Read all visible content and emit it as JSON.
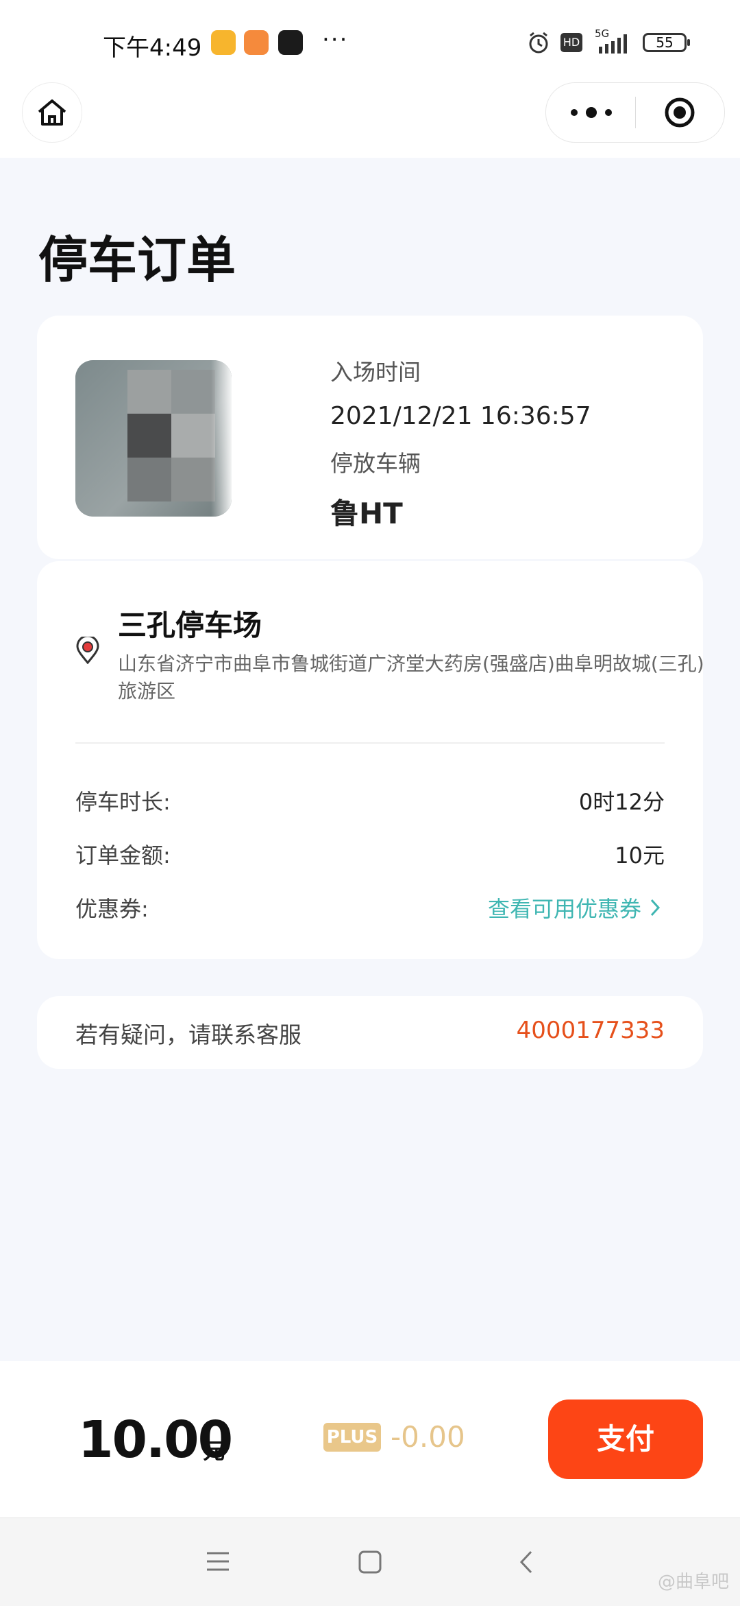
{
  "status_bar": {
    "time": "下午4:49",
    "more": "···",
    "hd_label": "HD",
    "network": "5G",
    "battery": "55"
  },
  "nav": {
    "home_icon": "home-icon",
    "more_icon": "more-dots-icon",
    "close_icon": "target-circle-icon"
  },
  "page": {
    "title": "停车订单"
  },
  "order": {
    "entry_label": "入场时间",
    "entry_time": "2021/12/21 16:36:57",
    "plate_label": "停放车辆",
    "plate_value": "鲁HT"
  },
  "lot": {
    "name": "三孔停车场",
    "address": "山东省济宁市曲阜市鲁城街道广济堂大药房(强盛店)曲阜明故城(三孔)旅游区"
  },
  "details": {
    "duration_label": "停车时长:",
    "duration_value": "0时12分",
    "amount_label": "订单金额:",
    "amount_value": "10元",
    "coupon_label": "优惠券:",
    "coupon_link": "查看可用优惠券"
  },
  "contact": {
    "text": "若有疑问，请联系客服",
    "phone": "4000177333"
  },
  "payment": {
    "amount": "10.00",
    "unit": "元",
    "plus_badge": "PLUS",
    "discount": "-0.00",
    "pay_label": "支付"
  },
  "system_nav": {
    "watermark": "@曲阜吧"
  },
  "colors": {
    "accent": "#fd4515",
    "phone": "#e6501b",
    "link": "#3fb6b2",
    "plus": "#e9c78a"
  }
}
